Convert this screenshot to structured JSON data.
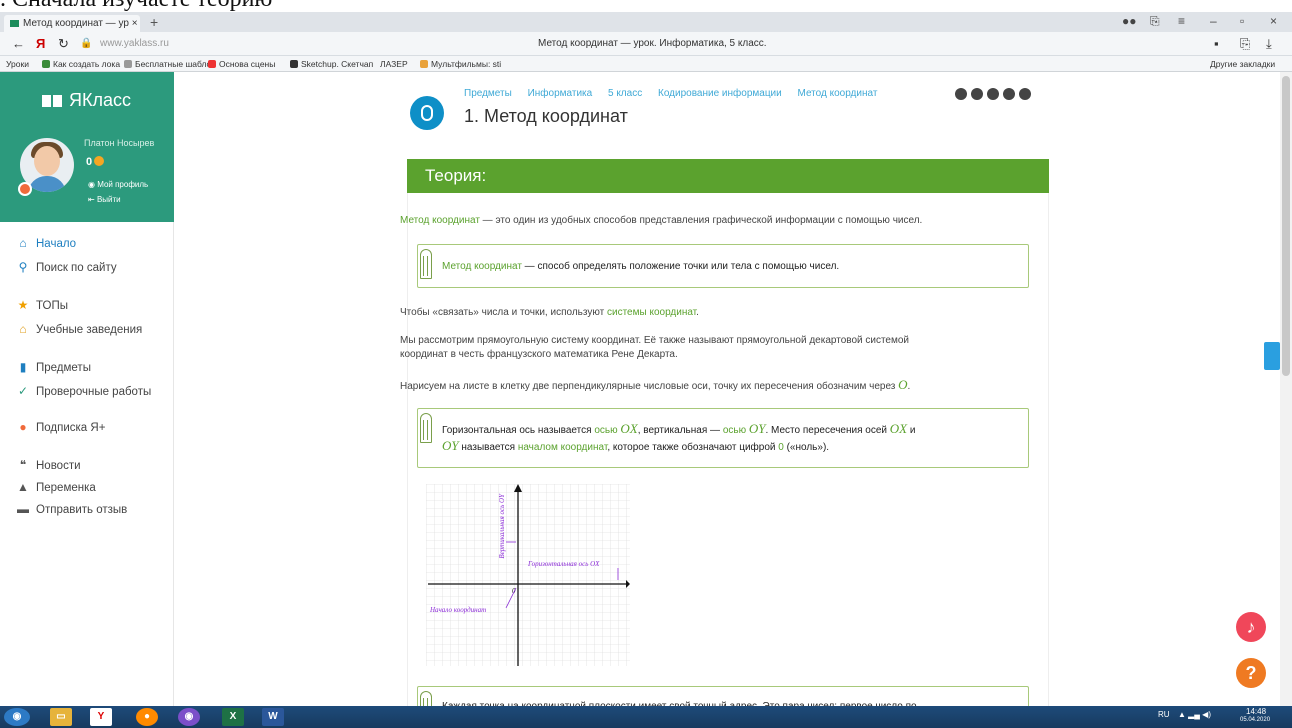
{
  "caption": ". Сначала изучаете теорию",
  "browser": {
    "tab_title": "Метод координат — ур",
    "url": "www.yaklass.ru",
    "page_title": "Метод координат — урок. Информатика, 5 класс."
  },
  "bookmarks": [
    "Уроки",
    "Как создать лока",
    "Бесплатные шабло",
    "Основа сцены",
    "Sketchup. Скетчап",
    "ЛАЗЕР",
    "Мультфильмы: sti",
    "Другие закладки"
  ],
  "sidebar": {
    "logo": "ЯКласс",
    "user_name": "Платон Носырев",
    "score": "0",
    "profile_link": "Мой профиль",
    "logout_link": "Выйти",
    "menu": [
      {
        "label": "Начало",
        "icon": "home-icon"
      },
      {
        "label": "Поиск по сайту",
        "icon": "search-icon"
      },
      {
        "label": "ТОПы",
        "icon": "star-icon"
      },
      {
        "label": "Учебные заведения",
        "icon": "school-icon"
      },
      {
        "label": "Предметы",
        "icon": "books-icon"
      },
      {
        "label": "Проверочные работы",
        "icon": "check-icon"
      },
      {
        "label": "Подписка Я+",
        "icon": "plus-icon"
      },
      {
        "label": "Новости",
        "icon": "news-icon"
      },
      {
        "label": "Переменка",
        "icon": "bell-icon"
      },
      {
        "label": "Отправить отзыв",
        "icon": "feedback-icon"
      }
    ]
  },
  "breadcrumbs": [
    "Предметы",
    "Информатика",
    "5 класс",
    "Кодирование информации",
    "Метод координат"
  ],
  "lesson_title": "1. Метод координат",
  "theory": {
    "header": "Теория:",
    "p1_term": "Метод координат",
    "p1_rest": " — это один из удобных способов представления графической информации с помощью чисел.",
    "def_term": "Метод координат",
    "def_rest": " — способ определять положение точки или тела с помощью чисел.",
    "p2_a": "Чтобы «связать» числа и точки, используют ",
    "p2_link": "системы координат",
    "p2_b": ".",
    "p3_l1": "Мы рассмотрим прямоугольную систему координат. Её также называют прямоугольной декартовой системой",
    "p3_l2": "координат в честь французского математика Рене Декарта.",
    "p4": "Нарисуем на листе в клетку две перпендикулярные числовые оси, точку их пересечения обозначим через ",
    "p4_var": "O",
    "box2_a": "Горизонтальная ось называется ",
    "box2_ox_link": "осью ",
    "box2_ox": "OX",
    "box2_b": ", вертикальная — ",
    "box2_oy_link": "осью ",
    "box2_oy": "OY",
    "box2_c": ". Место пересечения осей ",
    "box2_ox2": "OX",
    "box2_d": " и",
    "box2_oy2": "OY",
    "box2_e": " называется ",
    "box2_origin": "началом координат",
    "box2_f": ", которое также обозначают цифрой ",
    "box2_zero": "0",
    "box2_g": " («ноль»).",
    "graph": {
      "y_axis_label": "Вертикальная ось OY",
      "x_axis_label": "Горизонтальная ось OX",
      "origin_label": "Начало координат",
      "origin_mark": "0"
    },
    "box3_text": "Каждая точка на координатной плоскости имеет свой точный адрес. Это пара чисел: первое число по"
  },
  "tray": {
    "lang": "RU",
    "time": "14:48",
    "date": "05.04.2020"
  },
  "colors": {
    "accent": "#5ba22e",
    "sidebar": "#2c9a7d",
    "link": "#3fa9d6"
  }
}
